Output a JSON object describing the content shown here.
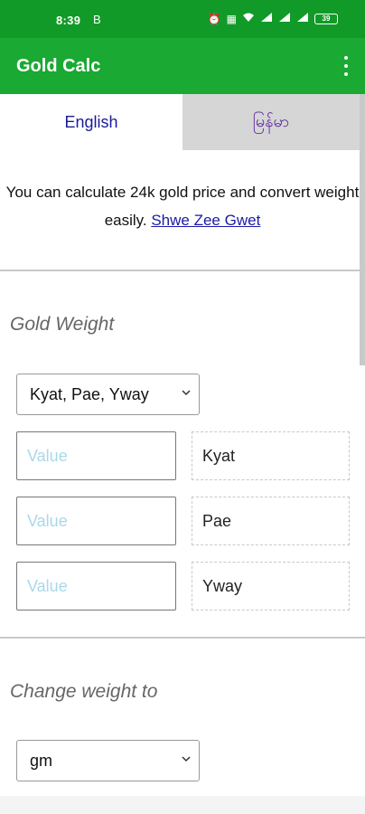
{
  "status_bar": {
    "time": "8:39",
    "indicator": "B",
    "icons": [
      "alarm-icon",
      "nfc-icon",
      "wifi-icon",
      "signal-icon",
      "signal-icon",
      "signal-icon"
    ],
    "battery": "39"
  },
  "app_bar": {
    "title": "Gold Calc",
    "menu_icon": "more-vert-icon"
  },
  "tabs": [
    {
      "label": "English",
      "active": true
    },
    {
      "label": "မြန်မာ",
      "active": false
    }
  ],
  "intro": {
    "text": "You can calculate 24k gold price and convert weight easily. ",
    "link": "Shwe Zee Gwet"
  },
  "gold_weight": {
    "title": "Gold Weight",
    "unit_select": "Kyat, Pae, Yway",
    "rows": [
      {
        "placeholder": "Value",
        "unit": "Kyat"
      },
      {
        "placeholder": "Value",
        "unit": "Pae"
      },
      {
        "placeholder": "Value",
        "unit": "Yway"
      }
    ]
  },
  "change_weight": {
    "title": "Change weight to",
    "unit_select": "gm"
  },
  "colors": {
    "status_bar": "#119a27",
    "app_bar": "#1aa933",
    "link": "#1a1aa8",
    "placeholder": "#a9d9e8"
  }
}
